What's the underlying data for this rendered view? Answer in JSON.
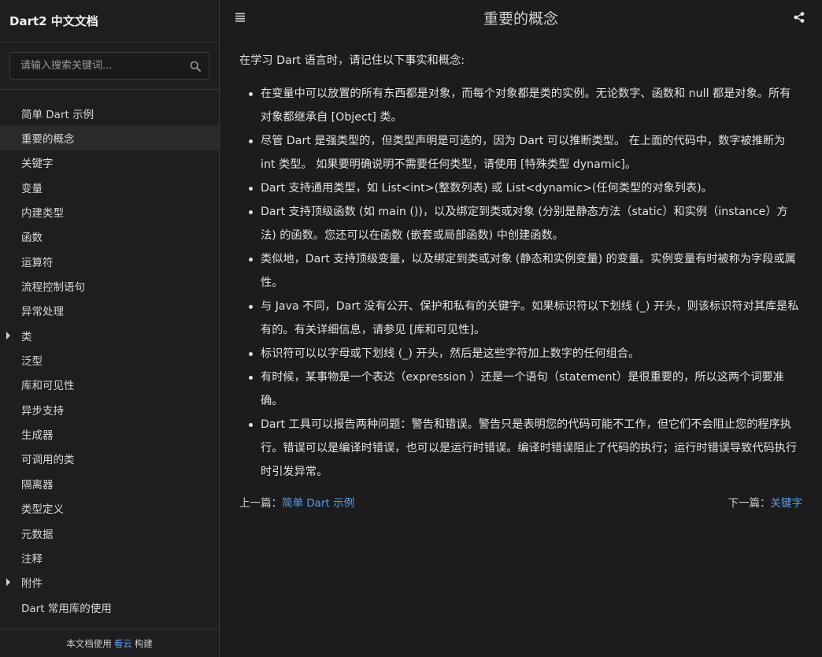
{
  "sidebar": {
    "title": "Dart2 中文文档",
    "search_placeholder": "请输入搜索关键词...",
    "items": [
      {
        "label": "简单 Dart 示例",
        "caret": false,
        "active": false
      },
      {
        "label": "重要的概念",
        "caret": false,
        "active": true
      },
      {
        "label": "关键字",
        "caret": false,
        "active": false
      },
      {
        "label": "变量",
        "caret": false,
        "active": false
      },
      {
        "label": "内建类型",
        "caret": false,
        "active": false
      },
      {
        "label": "函数",
        "caret": false,
        "active": false
      },
      {
        "label": "运算符",
        "caret": false,
        "active": false
      },
      {
        "label": "流程控制语句",
        "caret": false,
        "active": false
      },
      {
        "label": "异常处理",
        "caret": false,
        "active": false
      },
      {
        "label": "类",
        "caret": true,
        "active": false
      },
      {
        "label": "泛型",
        "caret": false,
        "active": false
      },
      {
        "label": "库和可见性",
        "caret": false,
        "active": false
      },
      {
        "label": "异步支持",
        "caret": false,
        "active": false
      },
      {
        "label": "生成器",
        "caret": false,
        "active": false
      },
      {
        "label": "可调用的类",
        "caret": false,
        "active": false
      },
      {
        "label": "隔离器",
        "caret": false,
        "active": false
      },
      {
        "label": "类型定义",
        "caret": false,
        "active": false
      },
      {
        "label": "元数据",
        "caret": false,
        "active": false
      },
      {
        "label": "注释",
        "caret": false,
        "active": false
      },
      {
        "label": "附件",
        "caret": true,
        "active": false
      },
      {
        "label": "Dart 常用库的使用",
        "caret": false,
        "active": false
      }
    ],
    "footer": {
      "prefix": "本文档使用",
      "link": "看云",
      "suffix": "构建"
    }
  },
  "header": {
    "title": "重要的概念",
    "menu_icon": "list-icon",
    "share_icon": "share-icon"
  },
  "content": {
    "intro": "在学习 Dart 语言时，请记住以下事实和概念:",
    "points": [
      "在变量中可以放置的所有东西都是对象，而每个对象都是类的实例。无论数字、函数和 null 都是对象。所有对象都继承自 [Object] 类。",
      "尽管 Dart 是强类型的，但类型声明是可选的，因为 Dart 可以推断类型。 在上面的代码中，数字被推断为 int 类型。 如果要明确说明不需要任何类型，请使用 [特殊类型 dynamic]。",
      "Dart 支持通用类型，如 List<int>(整数列表) 或 List<dynamic>(任何类型的对象列表)。",
      "Dart 支持顶级函数 (如 main ())，以及绑定到类或对象 (分别是静态方法（static）和实例（instance）方法) 的函数。您还可以在函数 (嵌套或局部函数) 中创建函数。",
      "类似地，Dart 支持顶级变量，以及绑定到类或对象 (静态和实例变量) 的变量。实例变量有时被称为字段或属性。",
      "与 Java 不同，Dart 没有公开、保护和私有的关键字。如果标识符以下划线 (_) 开头，则该标识符对其库是私有的。有关详细信息，请参见 [库和可见性]。",
      "标识符可以以字母或下划线 (_) 开头，然后是这些字符加上数字的任何组合。",
      "有时候，某事物是一个表达（expression ）还是一个语句（statement）是很重要的，所以这两个词要准确。",
      "Dart 工具可以报告两种问题：警告和错误。警告只是表明您的代码可能不工作，但它们不会阻止您的程序执行。错误可以是编译时错误，也可以是运行时错误。编译时错误阻止了代码的执行；运行时错误导致代码执行时引发异常。"
    ]
  },
  "pager": {
    "prev_prefix": "上一篇：",
    "prev_link": "简单 Dart 示例",
    "next_prefix": "下一篇：",
    "next_link": "关键字"
  },
  "colors": {
    "link": "#5aa0e8",
    "background": "#1c1c1e"
  }
}
